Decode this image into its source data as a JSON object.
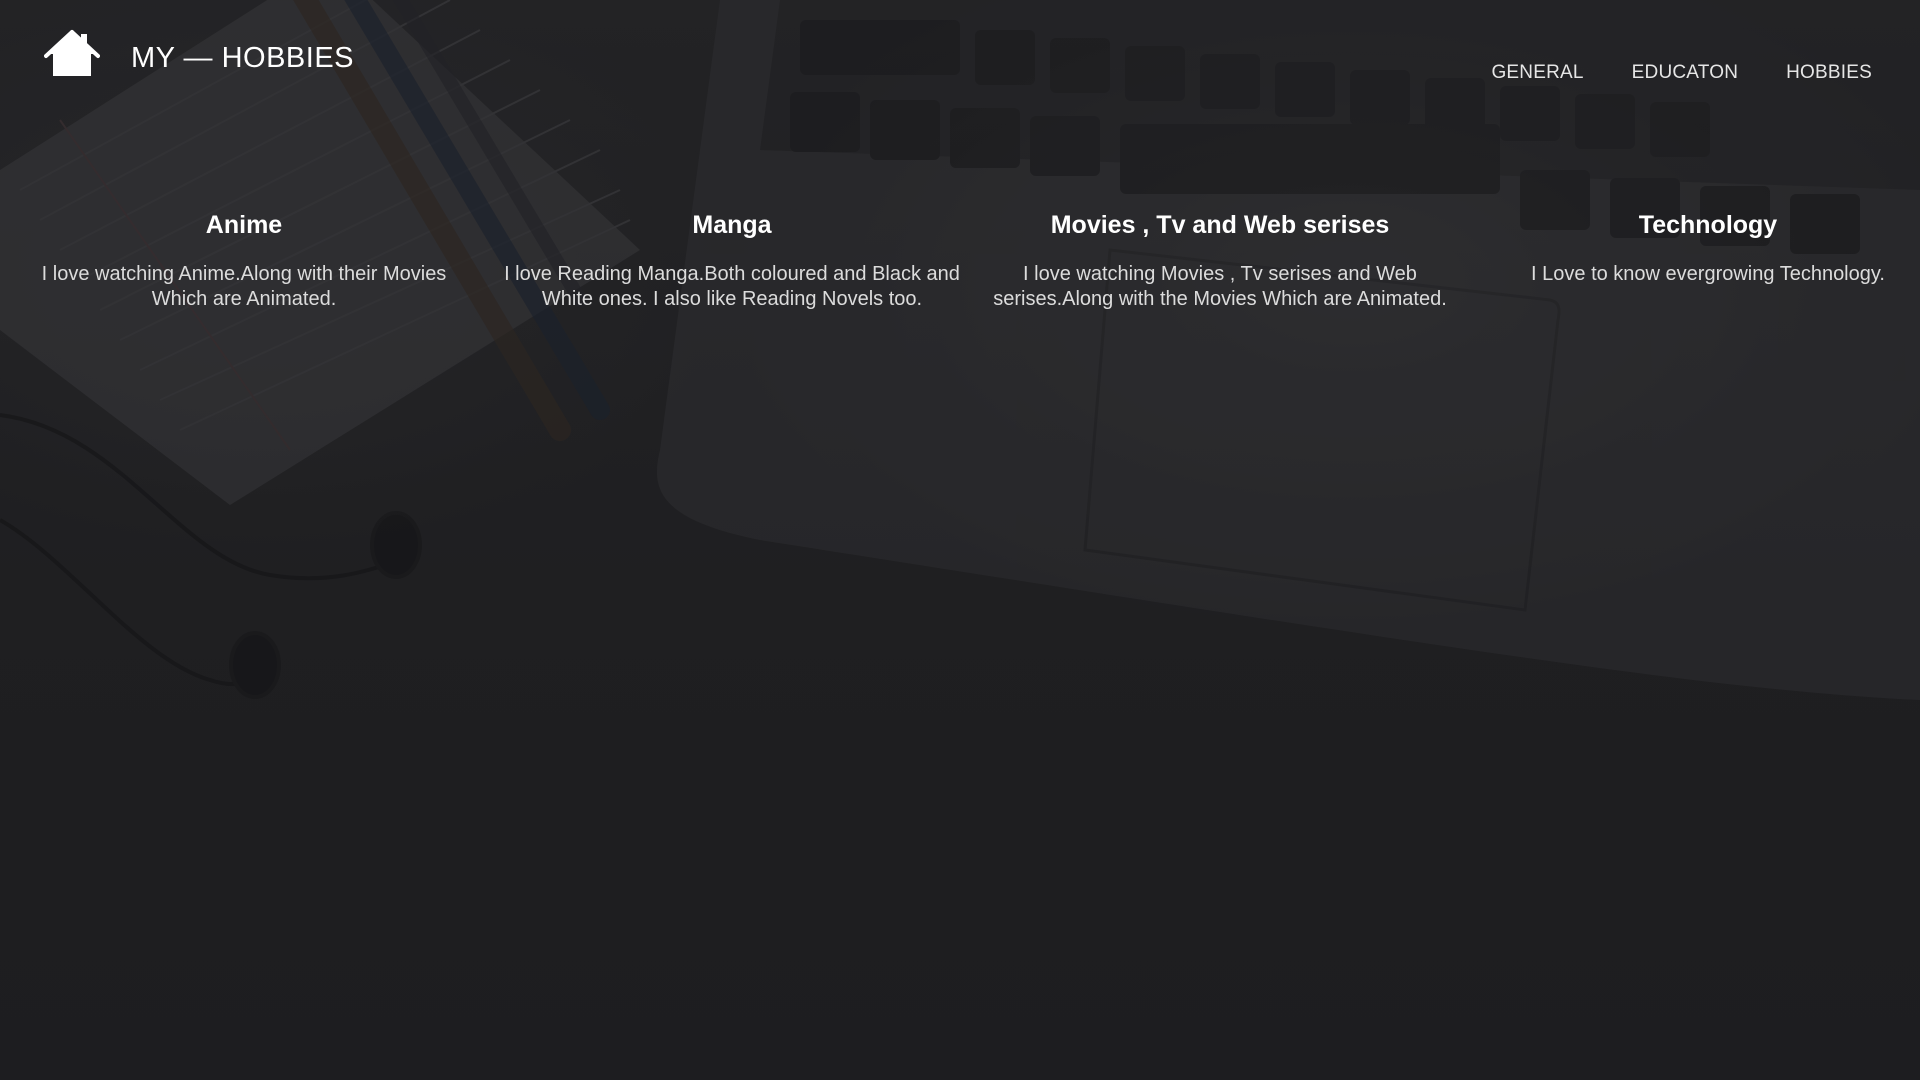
{
  "header": {
    "title": "MY — HOBBIES",
    "logo_icon": "home-icon"
  },
  "nav": {
    "items": [
      {
        "label": "GENERAL"
      },
      {
        "label": "EDUCATON"
      },
      {
        "label": "HOBBIES"
      }
    ]
  },
  "hobbies": [
    {
      "title": "Anime",
      "text": "I love watching Anime.Along with their Movies Which are Animated."
    },
    {
      "title": "Manga",
      "text": "I love Reading Manga.Both coloured and Black and White ones. I also like Reading Novels too."
    },
    {
      "title": "Movies , Tv and Web serises",
      "text": "I love watching Movies , Tv serises and Web serises.Along with the Movies Which are Animated."
    },
    {
      "title": "Technology",
      "text": "I Love to know evergrowing Technology."
    }
  ],
  "colors": {
    "background": "#242426",
    "text": "#ffffff",
    "muted_text": "#dcdcdc"
  }
}
